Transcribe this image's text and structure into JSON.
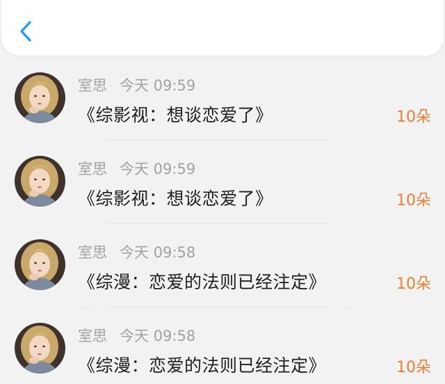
{
  "header": {
    "back_icon": "chevron-left-icon",
    "accent_color": "#1a9bff"
  },
  "colors": {
    "name_time": "#a2a2a2",
    "title": "#1e1e1e",
    "amount": "#f07d32",
    "background": "#f2f2f2"
  },
  "records": [
    {
      "name": "室思",
      "time": "今天 09:59",
      "title": "《综影视：想谈恋爱了》",
      "amount": "10朵"
    },
    {
      "name": "室思",
      "time": "今天 09:59",
      "title": "《综影视：想谈恋爱了》",
      "amount": "10朵"
    },
    {
      "name": "室思",
      "time": "今天 09:58",
      "title": "《综漫：恋爱的法则已经注定》",
      "amount": "10朵"
    },
    {
      "name": "室思",
      "time": "今天 09:58",
      "title": "《综漫：恋爱的法则已经注定》",
      "amount": "10朵"
    }
  ]
}
